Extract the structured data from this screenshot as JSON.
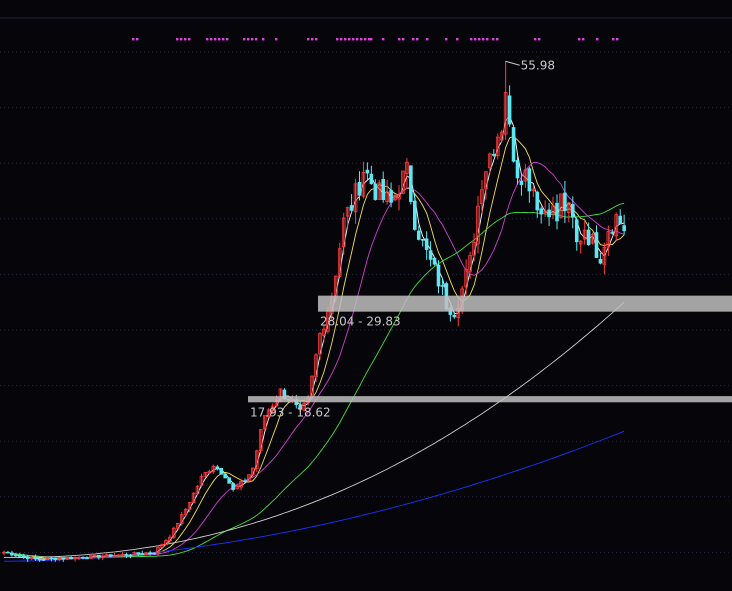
{
  "chart_data": {
    "type": "candlestick",
    "peak_label": "55.98",
    "zones": [
      {
        "label": "28.04 - 29.83",
        "low": 28.04,
        "high": 29.83
      },
      {
        "label": "17.93 - 18.62",
        "low": 17.93,
        "high": 18.62
      }
    ],
    "colors": {
      "background": "#05050a",
      "grid": "#2a2a45",
      "up": "#ff3b3b",
      "down": "#5fe6f0",
      "zone": "#bfbfbf",
      "marker": "#e040e0",
      "ma_white": "#ffffff",
      "ma_yellow": "#f5e050",
      "ma_magenta": "#d040d0",
      "ma_green": "#40e040",
      "ma_gray": "#cfcfcf",
      "ma_blue": "#2030ff"
    }
  }
}
